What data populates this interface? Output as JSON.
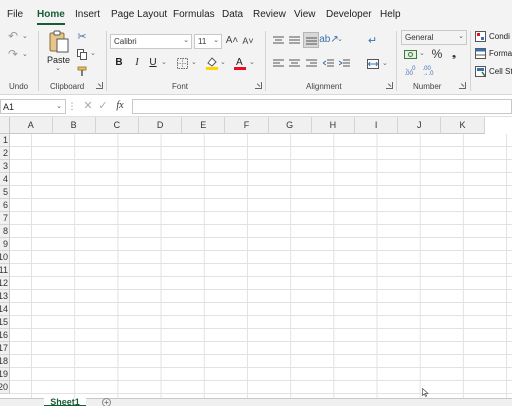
{
  "menu": [
    "File",
    "Home",
    "Insert",
    "Page Layout",
    "Formulas",
    "Data",
    "Review",
    "View",
    "Developer",
    "Help"
  ],
  "ribbon": {
    "undo_label": "Undo",
    "clipboard": {
      "label": "Clipboard",
      "paste_label": "Paste"
    },
    "font": {
      "label": "Font",
      "family": "Calibri",
      "size": "11"
    },
    "alignment": {
      "label": "Alignment"
    },
    "number": {
      "label": "Number",
      "format": "General"
    },
    "styles": {
      "items": [
        "Condi",
        "Forma",
        "Cell St"
      ]
    }
  },
  "formula_bar": {
    "name_box": "A1",
    "fx": "fx",
    "value": ""
  },
  "grid": {
    "columns": [
      "A",
      "B",
      "C",
      "D",
      "E",
      "F",
      "G",
      "H",
      "I",
      "J",
      "K"
    ],
    "rows": [
      "1",
      "2",
      "3",
      "4",
      "5",
      "6",
      "7",
      "8",
      "9",
      "10",
      "11",
      "12",
      "13",
      "14",
      "15",
      "16",
      "17",
      "18",
      "19",
      "20"
    ]
  },
  "sheets": [
    "Sheet1"
  ],
  "colors": {
    "accent": "#185c37",
    "font_color": "#e81123",
    "fill_color": "#ffd400"
  }
}
